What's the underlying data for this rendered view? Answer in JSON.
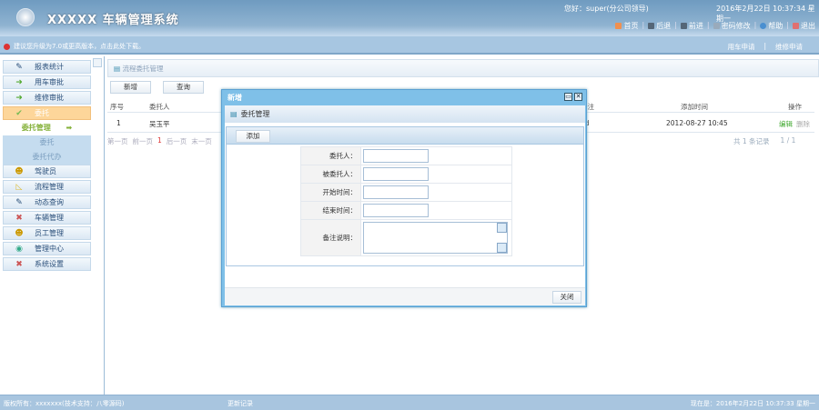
{
  "header": {
    "system_name": "XXXXX  车辆管理系统",
    "greeting": "您好：super(分公司领导)",
    "datetime": "2016年2月22日 10:37:34 星期一",
    "nav": [
      "首页",
      "后退",
      "前进",
      "密码修改",
      "帮助",
      "退出"
    ]
  },
  "notice": {
    "text": "建议您升级为7.0或更高版本，点击此处下载。",
    "quick_links": [
      "用车申请",
      "维修申请"
    ]
  },
  "sidebar": {
    "items": [
      "报表统计",
      "用车审批",
      "维修审批",
      "委托",
      "驾驶员",
      "流程管理",
      "动态查询",
      "车辆管理",
      "员工管理",
      "管理中心",
      "系统设置"
    ],
    "submenu": "委托管理",
    "sub_items": [
      "委托",
      "委托代办"
    ]
  },
  "main": {
    "breadcrumb": "流程委托管理",
    "buttons": {
      "add": "新增",
      "query": "查询"
    },
    "columns": [
      "序号",
      "委托人",
      "备注",
      "添加时间",
      "操作"
    ],
    "rows": [
      {
        "index": "1",
        "delegator": "吴玉平",
        "remark": "ifd",
        "added": "2012-08-27 10:45",
        "edit": "编辑",
        "delete": "删除"
      }
    ],
    "pager": {
      "first": "第一页",
      "prev": "前一页",
      "current": "1",
      "next": "后一页",
      "last": "末一页",
      "total": "共 1 条记录",
      "pages": "1 / 1"
    }
  },
  "dialog": {
    "title": "新增",
    "breadcrumb": "委托管理",
    "add_button": "添加",
    "fields": {
      "delegator": "委托人：",
      "delegatee": "被委托人：",
      "start": "开始时间：",
      "end": "结束时间：",
      "remark": "备注说明："
    },
    "close_button": "关闭"
  },
  "footer": {
    "copyright": "版权所有：xxxxxxx(技术支持：八零源码)",
    "changelog": "更新记录",
    "now": "现在是：2016年2月22日 10:37:33 星期一"
  }
}
